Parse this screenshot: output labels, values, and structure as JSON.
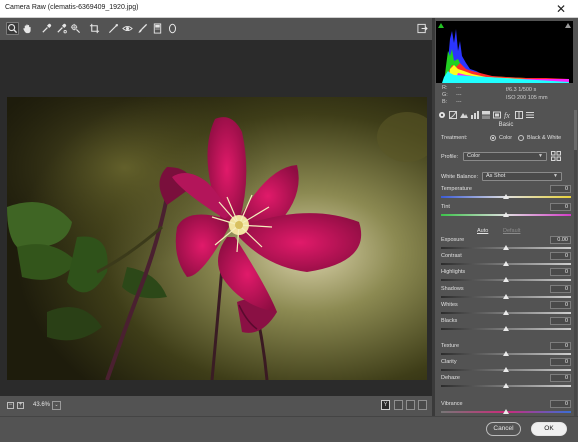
{
  "window": {
    "title": "Camera Raw (clematis-6369409_1920.jpg)",
    "close_glyph": "✕"
  },
  "toolbar": {
    "tools": [
      "zoom-tool-icon",
      "hand-tool-icon",
      "white-balance-tool-icon",
      "color-sampler-tool-icon",
      "targeted-adjustment-tool-icon",
      "crop-tool-icon",
      "straighten-tool-icon",
      "red-eye-tool-icon",
      "adjustment-brush-icon",
      "graduated-filter-icon",
      "radial-filter-icon"
    ],
    "open_image_icon": "open-image-icon"
  },
  "status": {
    "zoom_out": "−",
    "zoom_in": "+",
    "zoom_value": "43.6%",
    "zoom_dropdown_glyph": "⌄",
    "view_buttons": [
      "Y",
      "",
      "",
      ""
    ]
  },
  "histogram": {
    "colors": [
      "#ff2222",
      "#22dd22",
      "#2244ff",
      "#ffff00",
      "#ff00ff",
      "#00ffff"
    ]
  },
  "rgb_readout": {
    "r_label": "R:",
    "g_label": "G:",
    "b_label": "B:",
    "r_value": "---",
    "g_value": "---",
    "b_value": "---",
    "aperture_shutter": "f/6.3   1/500 s",
    "iso_focal": "ISO 200   105 mm"
  },
  "panel": {
    "title": "Basic",
    "treatment_label": "Treatment:",
    "treatment_color": "Color",
    "treatment_bw": "Black & White",
    "profile_label": "Profile:",
    "profile_value": "Color",
    "white_balance_label": "White Balance:",
    "white_balance_value": "As Shot",
    "auto_label": "Auto",
    "default_label": "Default",
    "sliders": [
      {
        "label": "Temperature",
        "value": "0",
        "position": 0.5
      },
      {
        "label": "Tint",
        "value": "0",
        "position": 0.5
      },
      {
        "label": "Exposure",
        "value": "0.00",
        "position": 0.5
      },
      {
        "label": "Contrast",
        "value": "0",
        "position": 0.5
      },
      {
        "label": "Highlights",
        "value": "0",
        "position": 0.5
      },
      {
        "label": "Shadows",
        "value": "0",
        "position": 0.5
      },
      {
        "label": "Whites",
        "value": "0",
        "position": 0.5
      },
      {
        "label": "Blacks",
        "value": "0",
        "position": 0.5
      },
      {
        "label": "Texture",
        "value": "0",
        "position": 0.5
      },
      {
        "label": "Clarity",
        "value": "0",
        "position": 0.5
      },
      {
        "label": "Dehaze",
        "value": "0",
        "position": 0.5
      },
      {
        "label": "Vibrance",
        "value": "0",
        "position": 0.5
      }
    ]
  },
  "footer": {
    "cancel_label": "Cancel",
    "ok_label": "OK"
  },
  "colors": {
    "accent_magenta": "#c2185b",
    "panel_bg": "#535353",
    "canvas_bg": "#2b2b2b"
  }
}
